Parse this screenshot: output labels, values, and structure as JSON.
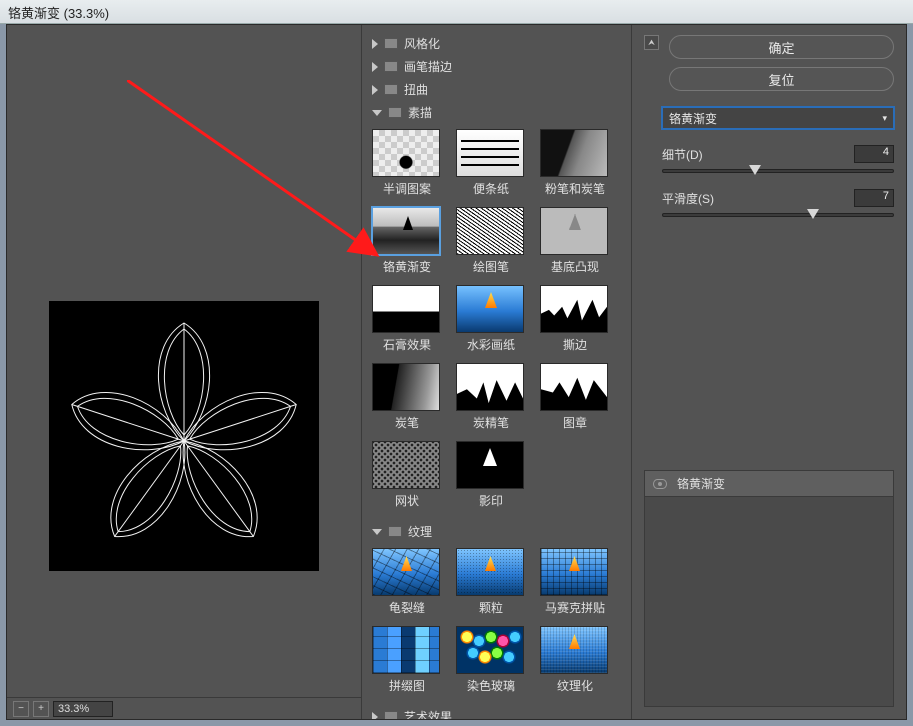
{
  "title": "铬黄渐变 (33.3%)",
  "preview_zoom": "33.3%",
  "buttons": {
    "ok": "确定",
    "reset": "复位"
  },
  "filter_select": "铬黄渐变",
  "params": {
    "detail": {
      "label": "细节(D)",
      "value": "4",
      "pos_pct": 40
    },
    "smooth": {
      "label": "平滑度(S)",
      "value": "7",
      "pos_pct": 65
    }
  },
  "layers": {
    "active": "铬黄渐变"
  },
  "folders": {
    "stylize": "风格化",
    "brush": "画笔描边",
    "distort": "扭曲",
    "sketch": "素描",
    "texture": "纹理",
    "artistic": "艺术效果"
  },
  "sketch": {
    "halftone": "半调图案",
    "note": "便条纸",
    "chalk": "粉笔和炭笔",
    "chrome": "铬黄渐变",
    "graphic": "绘图笔",
    "bas": "基底凸现",
    "plaster": "石膏效果",
    "water": "水彩画纸",
    "torn": "撕边",
    "charcoal": "炭笔",
    "conte": "炭精笔",
    "stamp": "图章",
    "retic": "网状",
    "photocopy": "影印"
  },
  "texture": {
    "craq": "龟裂缝",
    "grain": "颗粒",
    "mosaic": "马赛克拼贴",
    "patch": "拼缀图",
    "glass": "染色玻璃",
    "texturize": "纹理化"
  }
}
